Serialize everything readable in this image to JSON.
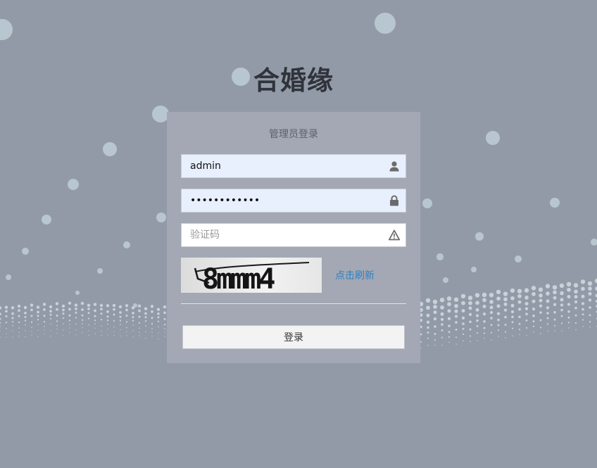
{
  "app": {
    "title": "合婚缘"
  },
  "login": {
    "heading": "管理员登录",
    "username": {
      "value": "admin",
      "icon": "user-icon"
    },
    "password": {
      "value": "••••••••••••",
      "icon": "lock-icon"
    },
    "captcha": {
      "placeholder": "验证码",
      "icon": "warning-icon",
      "image_text": "8mmm4"
    },
    "refresh_label": "点击刷新",
    "submit_label": "登录"
  },
  "colors": {
    "background": "#939aa7",
    "panel": "#a3a8b4",
    "bubble": "#b8c6cf",
    "link": "#2d7fc1",
    "autofill": "#e8f0fe"
  }
}
